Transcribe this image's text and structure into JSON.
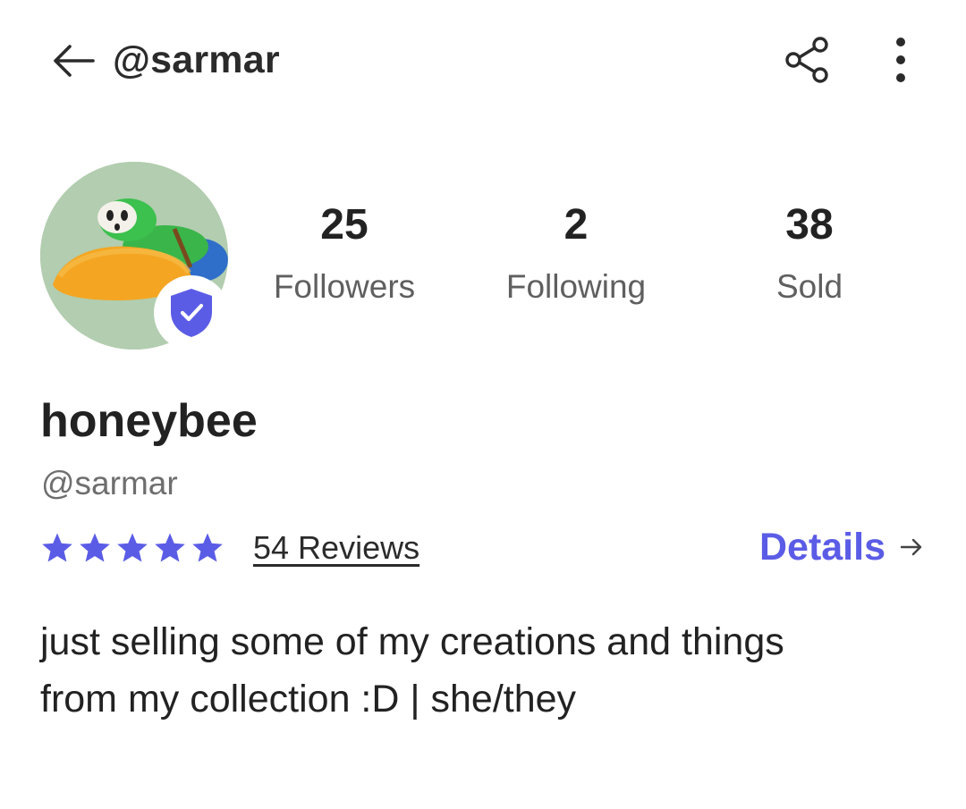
{
  "header": {
    "title": "@sarmar",
    "back_icon": "arrow-left-icon",
    "share_icon": "share-icon",
    "more_icon": "more-vertical-icon"
  },
  "profile": {
    "display_name": "honeybee",
    "username": "@sarmar",
    "verified": true,
    "verified_icon": "verified-shield-icon",
    "bio": "just selling some of my creations and things\nfrom my collection :D | she/they"
  },
  "stats": [
    {
      "value": "25",
      "label": "Followers"
    },
    {
      "value": "2",
      "label": "Following"
    },
    {
      "value": "38",
      "label": "Sold"
    }
  ],
  "rating": {
    "stars": 5,
    "reviews_label": "54 Reviews"
  },
  "details": {
    "label": "Details"
  },
  "colors": {
    "accent": "#5b5ce6",
    "text": "#222222",
    "muted": "#6e6e6e"
  }
}
